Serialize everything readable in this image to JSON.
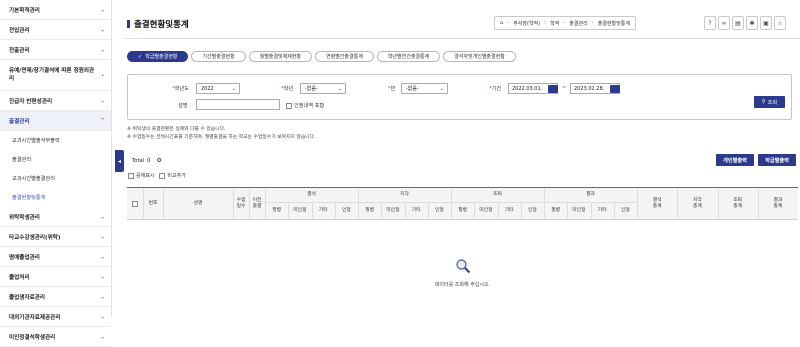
{
  "sidebar": {
    "items": [
      {
        "label": "기본학적관리"
      },
      {
        "label": "전입관리"
      },
      {
        "label": "전출관리"
      },
      {
        "label": "유예/면제/장기결석에 따른 정원외관리"
      },
      {
        "label": "진급자 반편성관리"
      },
      {
        "label": "출결관리",
        "sub": [
          "교과시간별출석부출력",
          "출결관리",
          "교과시간별출결관리",
          "출결현황및통계"
        ]
      },
      {
        "label": "위탁학생관리"
      },
      {
        "label": "타교수강생관리(위탁)"
      },
      {
        "label": "명예졸업관리"
      },
      {
        "label": "졸업처리"
      },
      {
        "label": "졸업생자료관리"
      },
      {
        "label": "대외기관자료제공관리"
      },
      {
        "label": "미인정결석학생관리"
      }
    ]
  },
  "page": {
    "title": "출결현황및통계"
  },
  "breadcrumb": [
    "부서장(학적)",
    "학적",
    "출결관리",
    "출결현황및통계"
  ],
  "tabs": [
    "학급별출결현황",
    "기간별출결현황",
    "월별출결및체제현황",
    "연령별간출결통계",
    "학년별연간출결통계",
    "결석자및개인별출결현황"
  ],
  "filters": {
    "year_label": "학년도",
    "year_value": "2022",
    "grade_label": "학년",
    "grade_value": "-없음-",
    "class_label": "반",
    "class_value": "-없음-",
    "period_label": "기간",
    "date_from": "2022.03.01.",
    "date_to": "2023.02.28.",
    "date_sep": "~",
    "name_label": "성명",
    "name_value": "",
    "personal_label": "인정내역 포함",
    "search_label": "조회"
  },
  "notes": [
    "※ 위탁생의 출결현황은 실제와 다를 수 있습니다.",
    "※ 수업일수는 전체시간표를 기준하며, 월별출결을 하는 학교는 수업일수가 보여지지 않습니다."
  ],
  "total": {
    "label": "Total",
    "count": "0"
  },
  "options": {
    "hide_empty": "응애표시",
    "compare": "비교추가"
  },
  "buttons": {
    "personal": "개인별출력",
    "class": "학급별출력"
  },
  "grid": {
    "headers": {
      "no": "번호",
      "name": "성명",
      "days": "수업\n일수",
      "transfer": "이전\n출결",
      "groups": [
        "결석",
        "지각",
        "조퇴",
        "결과"
      ],
      "sub": [
        "질병",
        "미인정",
        "기타",
        "인정"
      ],
      "totals": [
        "결석\n총계",
        "지각\n총계",
        "조퇴\n총계",
        "결과\n총계"
      ]
    },
    "empty_message": "데이터를 조회해 주십시오."
  },
  "colors": {
    "primary": "#2b3a8c",
    "active_menu": "#2f3c9e"
  }
}
